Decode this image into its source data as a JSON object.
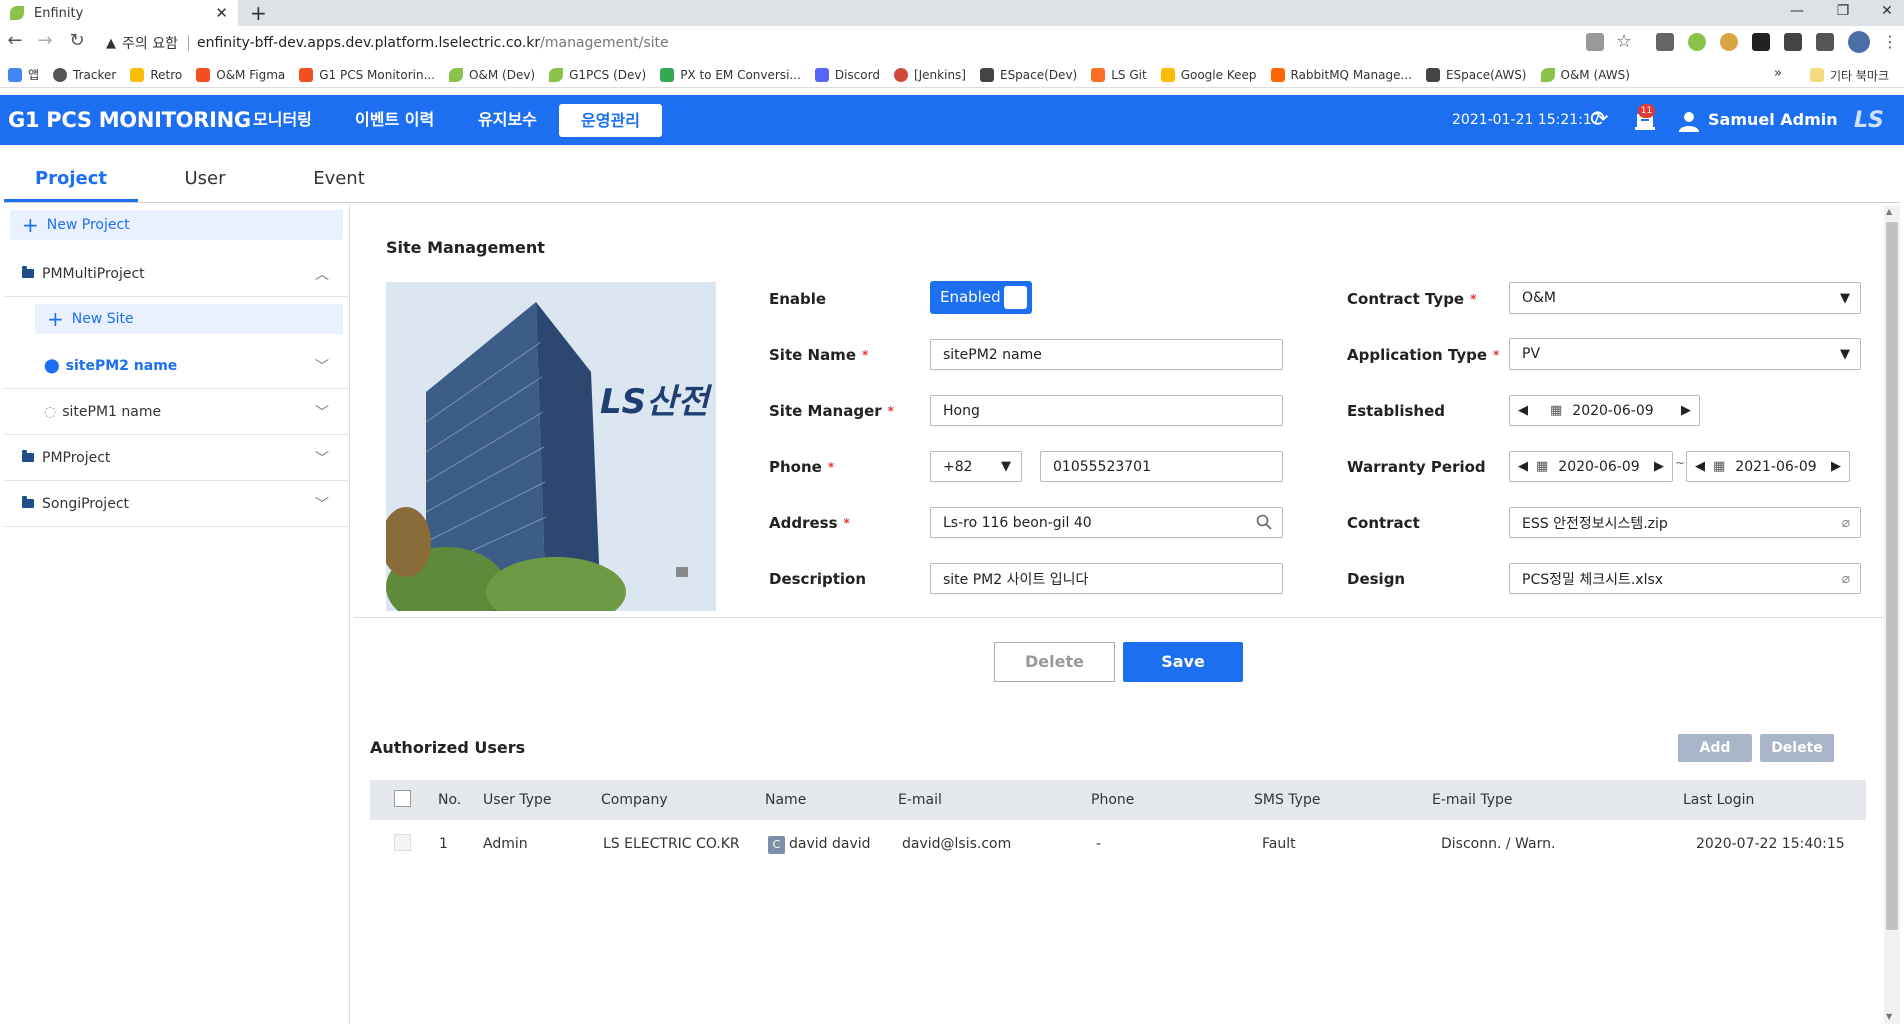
{
  "browser": {
    "tab_title": "Enfinity",
    "close": "✕",
    "new_tab": "+",
    "warning_text": "주의 요함",
    "url_host": "enfinity-bff-dev.apps.dev.platform.lselectric.co.kr",
    "url_path": "/management/site",
    "bookmarks": [
      {
        "label": "앱",
        "color": "#4285f4"
      },
      {
        "label": "Tracker",
        "color": "#555555"
      },
      {
        "label": "Retro",
        "color": "#fbbc04"
      },
      {
        "label": "O&M Figma",
        "color": "#f24e1e"
      },
      {
        "label": "G1 PCS Monitorin...",
        "color": "#f24e1e"
      },
      {
        "label": "O&M (Dev)",
        "color": "#8bc34a"
      },
      {
        "label": "G1PCS (Dev)",
        "color": "#8bc34a"
      },
      {
        "label": "PX to EM Conversi...",
        "color": "#34a853"
      },
      {
        "label": "Discord",
        "color": "#5865f2"
      },
      {
        "label": "[Jenkins]",
        "color": "#d24939"
      },
      {
        "label": "ESpace(Dev)",
        "color": "#444444"
      },
      {
        "label": "LS Git",
        "color": "#fc6d26"
      },
      {
        "label": "Google Keep",
        "color": "#fbbc04"
      },
      {
        "label": "RabbitMQ Manage...",
        "color": "#ff6600"
      },
      {
        "label": "ESpace(AWS)",
        "color": "#444444"
      },
      {
        "label": "O&M (AWS)",
        "color": "#8bc34a"
      }
    ],
    "bookmarks_more": "»",
    "other_bookmarks": "기타 북마크"
  },
  "header": {
    "title": "G1 PCS MONITORING",
    "nav": [
      "모니터링",
      "이벤트 이력",
      "유지보수",
      "운영관리"
    ],
    "datetime": "2021-01-21 15:21:17",
    "notification_count": "11",
    "user_name": "Samuel Admin",
    "logo": "LS"
  },
  "tabs": [
    "Project",
    "User",
    "Event"
  ],
  "sidebar": {
    "new_project": "New Project",
    "new_site": "New Site",
    "items": [
      {
        "label": "PMMultiProject"
      },
      {
        "label": "sitePM2 name"
      },
      {
        "label": "sitePM1 name"
      },
      {
        "label": "PMProject"
      },
      {
        "label": "SongiProject"
      }
    ]
  },
  "form": {
    "section_title": "Site Management",
    "image_logo": "LS산전",
    "enable_label": "Enable",
    "enable_value": "Enabled",
    "site_name_label": "Site Name",
    "site_name": "sitePM2 name",
    "site_manager_label": "Site Manager",
    "site_manager": "Hong",
    "phone_label": "Phone",
    "phone_code": "+82",
    "phone_number": "01055523701",
    "address_label": "Address",
    "address": "Ls-ro 116 beon-gil 40",
    "description_label": "Description",
    "description": "site PM2 사이트 입니다",
    "contract_type_label": "Contract Type",
    "contract_type": "O&M",
    "application_type_label": "Application Type",
    "application_type": "PV",
    "established_label": "Established",
    "established": "2020-06-09",
    "warranty_label": "Warranty Period",
    "warranty_start": "2020-06-09",
    "warranty_sep": "~",
    "warranty_end": "2021-06-09",
    "contract_label": "Contract",
    "contract_file": "ESS 안전정보시스템.zip",
    "design_label": "Design",
    "design_file": "PCS정밀 체크시트.xlsx",
    "required_mark": "*",
    "delete_label": "Delete",
    "save_label": "Save"
  },
  "users": {
    "title": "Authorized Users",
    "add_label": "Add",
    "delete_label": "Delete",
    "columns": [
      "No.",
      "User Type",
      "Company",
      "Name",
      "E-mail",
      "Phone",
      "SMS Type",
      "E-mail Type",
      "Last Login"
    ],
    "rows": [
      {
        "no": "1",
        "user_type": "Admin",
        "company": "LS ELECTRIC CO.KR",
        "badge": "C",
        "name": "david david",
        "email": "david@lsis.com",
        "phone": "-",
        "sms_type": "Fault",
        "email_type": "Disconn. / Warn.",
        "last_login": "2020-07-22 15:40:15"
      }
    ]
  },
  "colors": {
    "primary": "#1d6ff2",
    "header_bg": "#1d6ff2",
    "required": "#e53935",
    "secondary_button": "#a8b4c8"
  }
}
